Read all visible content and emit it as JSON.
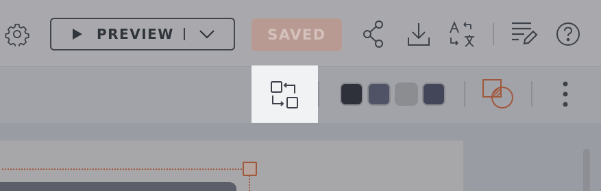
{
  "toolbar": {
    "preview_label": "PREVIEW",
    "saved_label": "SAVED",
    "icons": [
      "gear-icon",
      "play-icon",
      "chevron-down-icon",
      "share-icon",
      "download-icon",
      "translate-icon",
      "edit-notes-icon",
      "help-icon"
    ]
  },
  "subtoolbar": {
    "icons": [
      "swap-layout-icon",
      "shape-icon",
      "more-vertical-icon"
    ],
    "swatches": [
      {
        "name": "swatch-1",
        "color": "#2f313a"
      },
      {
        "name": "swatch-2",
        "color": "#505365"
      },
      {
        "name": "swatch-3",
        "color": "#8c8d91"
      },
      {
        "name": "swatch-4",
        "color": "#434659"
      }
    ]
  },
  "colors": {
    "accent": "#a0583d",
    "saved_button": "#b89a93",
    "active_tool_bg": "#f1f2f4"
  }
}
